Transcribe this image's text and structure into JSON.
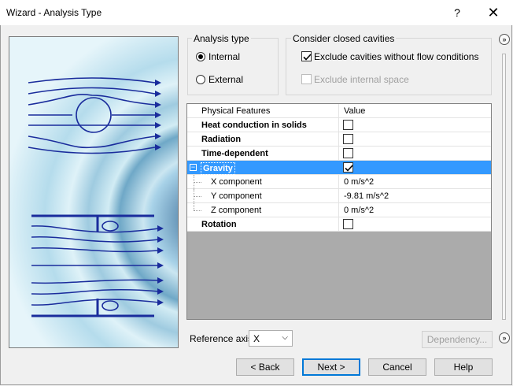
{
  "window": {
    "title": "Wizard - Analysis Type",
    "help_glyph": "?",
    "close_glyph": "✕"
  },
  "analysis_type": {
    "legend": "Analysis type",
    "options": [
      {
        "label": "Internal",
        "selected": true
      },
      {
        "label": "External",
        "selected": false
      }
    ]
  },
  "cavities": {
    "legend": "Consider closed cavities",
    "exclude_no_flow": {
      "label": "Exclude cavities without flow conditions",
      "checked": true
    },
    "exclude_internal": {
      "label": "Exclude internal space",
      "checked": false,
      "disabled": true
    }
  },
  "grid": {
    "headers": [
      "Physical Features",
      "Value"
    ],
    "rows": [
      {
        "label": "Heat conduction in solids",
        "type": "check",
        "checked": false
      },
      {
        "label": "Radiation",
        "type": "check",
        "checked": false
      },
      {
        "label": "Time-dependent",
        "type": "check",
        "checked": false
      },
      {
        "label": "Gravity",
        "type": "check",
        "checked": true,
        "selected": true,
        "expand": "−"
      },
      {
        "label": "X component",
        "type": "text",
        "value": "0 m/s^2"
      },
      {
        "label": "Y component",
        "type": "text",
        "value": "-9.81 m/s^2"
      },
      {
        "label": "Z component",
        "type": "text",
        "value": "0 m/s^2"
      },
      {
        "label": "Rotation",
        "type": "check",
        "checked": false
      }
    ]
  },
  "reference_axis": {
    "label": "Reference axis:",
    "value": "X",
    "arrow": "⌵"
  },
  "buttons": {
    "dependency": "Dependency...",
    "back": "< Back",
    "next": "Next >",
    "cancel": "Cancel",
    "help": "Help",
    "expand_top": "»",
    "expand_bottom": "»"
  },
  "colors": {
    "selection": "#3399ff",
    "arrow_blue": "#1a2c9c",
    "focus_border": "#0078d7"
  }
}
